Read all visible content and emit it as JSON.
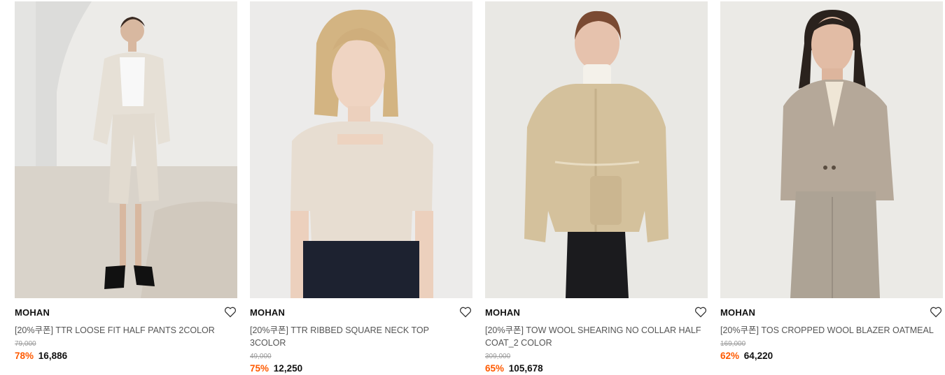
{
  "products": [
    {
      "brand": "MOHAN",
      "name": "[20%쿠폰] TTR LOOSE FIT HALF PANTS 2COLOR",
      "original_price": "79,000",
      "discount": "78%",
      "price": "16,886",
      "image_icon": "model-photo-beige-suit-shorts"
    },
    {
      "brand": "MOHAN",
      "name": "[20%쿠폰] TTR RIBBED SQUARE NECK TOP 3COLOR",
      "original_price": "49,000",
      "discount": "75%",
      "price": "12,250",
      "image_icon": "model-photo-square-neck-top"
    },
    {
      "brand": "MOHAN",
      "name": "[20%쿠폰] TOW WOOL SHEARING NO COLLAR HALF COAT_2 COLOR",
      "original_price": "309,000",
      "discount": "65%",
      "price": "105,678",
      "image_icon": "model-photo-shearing-coat"
    },
    {
      "brand": "MOHAN",
      "name": "[20%쿠폰] TOS CROPPED WOOL BLAZER OATMEAL",
      "original_price": "169,000",
      "discount": "62%",
      "price": "64,220",
      "image_icon": "model-photo-wool-blazer"
    }
  ],
  "colors": {
    "discount": "#ff5a00",
    "brand": "#111111",
    "name": "#555555",
    "original": "#999999"
  }
}
